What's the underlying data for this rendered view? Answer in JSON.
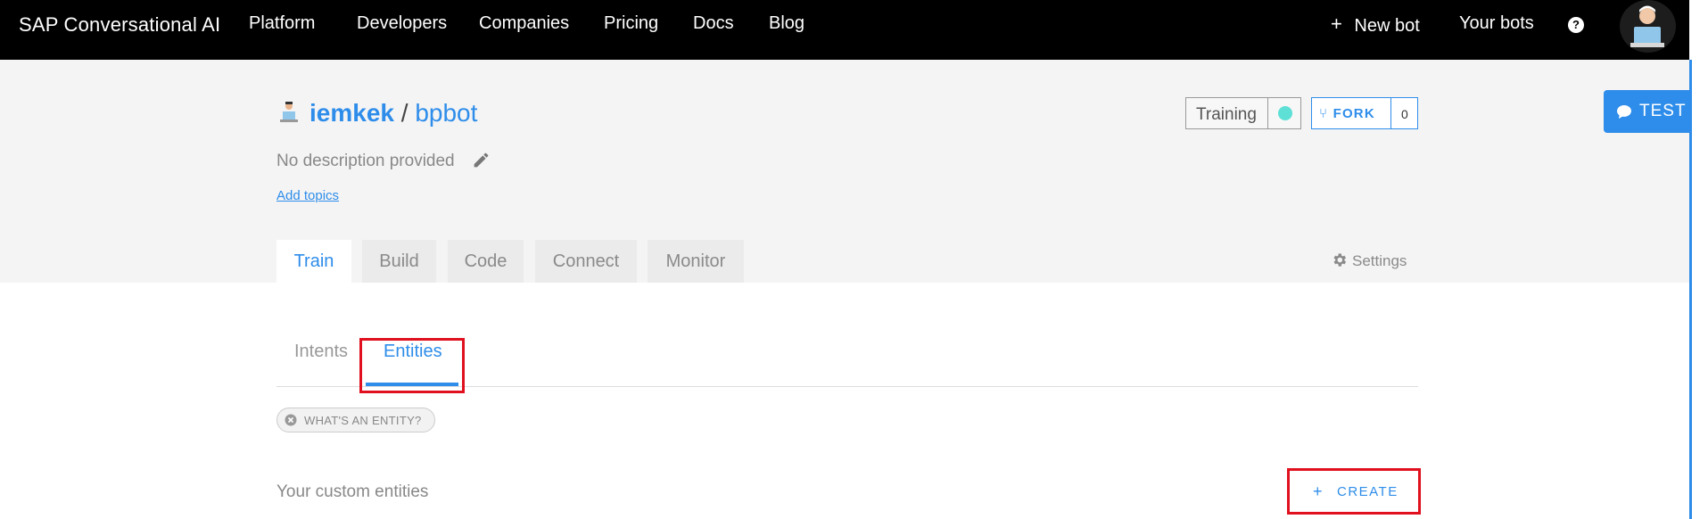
{
  "navbar": {
    "brand": "SAP Conversational AI",
    "links": [
      "Platform",
      "Developers",
      "Companies",
      "Pricing",
      "Docs",
      "Blog"
    ],
    "new_bot": "New bot",
    "your_bots": "Your bots",
    "help": "?"
  },
  "repo": {
    "owner": "iemkek",
    "separator": "/",
    "name": "bpbot",
    "description": "No description provided",
    "add_topics": "Add topics",
    "training_label": "Training",
    "training_status_color": "#5ee0d6",
    "fork_label": "FORK",
    "fork_count": "0",
    "test_label": "TEST"
  },
  "tabs": [
    "Train",
    "Build",
    "Code",
    "Connect",
    "Monitor"
  ],
  "active_tab": "Train",
  "settings_label": "Settings",
  "subtabs": {
    "intents": "Intents",
    "entities": "Entities",
    "active": "Entities"
  },
  "whats_entity": "WHAT'S AN ENTITY?",
  "custom_entities_heading": "Your custom entities",
  "create_label": "CREATE",
  "colors": {
    "accent": "#2e8dea",
    "navbar_bg": "#000000",
    "header_bg": "#f4f4f4",
    "highlight_red": "#e0101e"
  }
}
